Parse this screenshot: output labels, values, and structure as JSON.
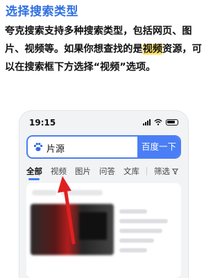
{
  "heading": "选择搜索类型",
  "paragraph": {
    "before": "夸克搜索支持多种搜索类型，包括网页、图片、视频等。如果你想查找的是",
    "highlight": "视频",
    "after": "资源，可以在搜索框下方选择“视频”选项。"
  },
  "phone": {
    "status_time": "19:15",
    "search_query": "片源",
    "search_button": "百度一下",
    "tabs": [
      "全部",
      "视频",
      "图片",
      "问答",
      "文库"
    ],
    "filter_label": "筛选",
    "accent": "#4a7ef5",
    "arrow_color": "#e02020"
  }
}
